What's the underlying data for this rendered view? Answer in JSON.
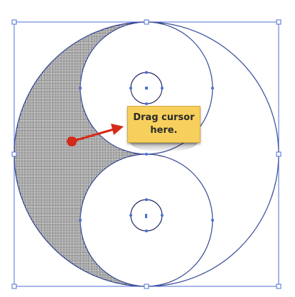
{
  "tooltip": {
    "text": "Drag cursor here."
  },
  "colors": {
    "path_stroke": "#2b2f6b",
    "selection_blue": "#4a6fd4",
    "fill_pattern_dot": "#4a4a4a",
    "arrow_red": "#d42a1a",
    "tooltip_bg": "#f7cf5c"
  },
  "icons": {
    "drag_arrow": "red-arrow-icon",
    "start_point": "red-dot-icon"
  }
}
